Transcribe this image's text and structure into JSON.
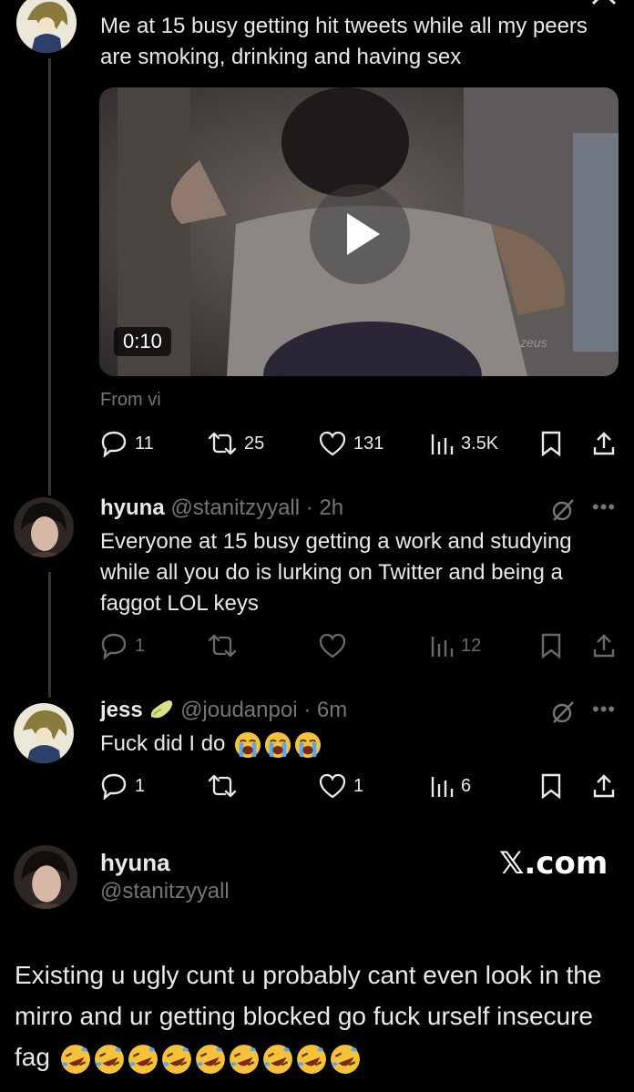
{
  "tweet1": {
    "text": "Me at 15 busy getting hit tweets while all my peers are smoking, drinking and having sex",
    "video": {
      "duration": "0:10",
      "watermark": "zeus"
    },
    "source": "From vi",
    "replies": "11",
    "retweets": "25",
    "likes": "131",
    "views": "3.5K"
  },
  "tweet2": {
    "name": "hyuna",
    "handle": "@stanitzyyall",
    "time": "· 2h",
    "text": "Everyone at 15 busy getting a work and studying while all you do is lurking on Twitter and being a faggot LOL keys",
    "replies": "1",
    "views": "12"
  },
  "tweet3": {
    "name": "jess",
    "handle": "@joudanpoi",
    "time": "· 6m",
    "text": "Fuck did I do",
    "replies": "1",
    "likes": "1",
    "views": "6"
  },
  "card": {
    "name": "hyuna",
    "handle": "@stanitzyyall",
    "brand": "𝕏.com",
    "text": "Existing u ugly cunt u probably cant even look in the mirro and ur getting blocked go fuck urself insecure fag"
  },
  "colors": {
    "background": "#000000",
    "text": "#e7e9ea",
    "muted": "#71767b",
    "line": "#333639"
  },
  "icons": [
    "reply-icon",
    "retweet-icon",
    "like-icon",
    "views-icon",
    "bookmark-icon",
    "share-icon",
    "grok-icon",
    "more-icon",
    "play-icon",
    "close-icon",
    "crying-emoji",
    "rofl-emoji",
    "avocado-emoji"
  ]
}
